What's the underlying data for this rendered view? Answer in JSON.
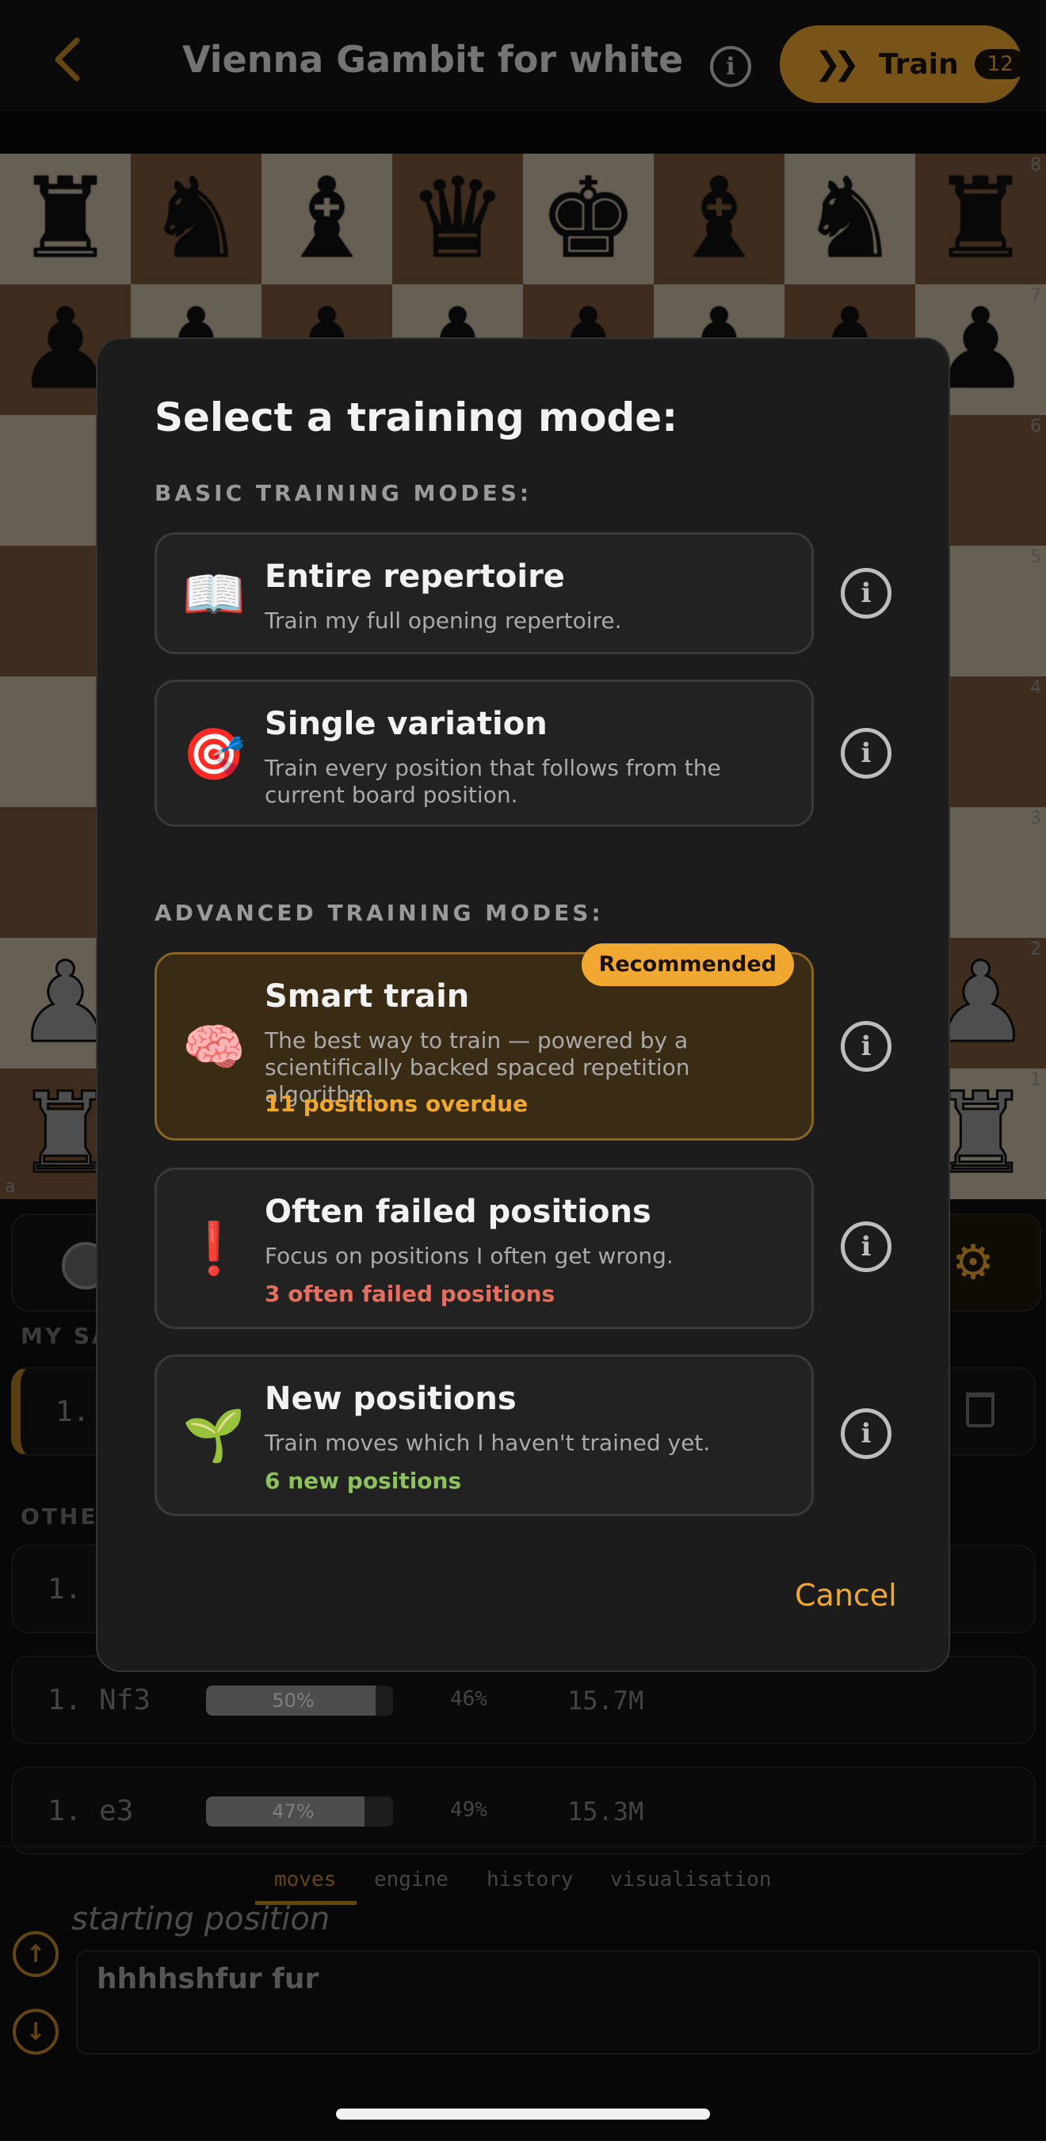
{
  "header": {
    "title": "Vienna Gambit for white",
    "train_label": "Train",
    "train_count": "12"
  },
  "board": {
    "rank_labels": [
      "8",
      "7",
      "6",
      "5",
      "4",
      "3",
      "2",
      "1"
    ],
    "file_label": "a"
  },
  "below_board": {
    "saved_section_label": "MY SA",
    "saved_move": "1.",
    "other_section_label": "OTHE",
    "other_moves": [
      {
        "move": "1.",
        "bar": "",
        "pct": "",
        "games": ""
      },
      {
        "move": "1. Nf3",
        "bar": "50%",
        "pct": "46%",
        "games": "15.7M"
      },
      {
        "move": "1. e3",
        "bar": "47%",
        "pct": "49%",
        "games": "15.3M"
      }
    ],
    "tabs": [
      "moves",
      "engine",
      "history",
      "visualisation"
    ],
    "starting_position": "starting position",
    "comment": "hhhhshfur fur"
  },
  "dialog": {
    "title": "Select a training mode:",
    "basic_label": "BASIC TRAINING MODES:",
    "advanced_label": "ADVANCED TRAINING MODES:",
    "modes": [
      {
        "icon": "📖",
        "title": "Entire repertoire",
        "desc": "Train my full opening repertoire.",
        "status": ""
      },
      {
        "icon": "🎯",
        "title": "Single variation",
        "desc": "Train every position that follows from the current board position.",
        "status": ""
      },
      {
        "icon": "🧠",
        "title": "Smart train",
        "desc": "The best way to train — powered by a scientifically backed spaced repetition algorithm.",
        "status": "11 positions overdue",
        "badge": "Recommended"
      },
      {
        "icon": "❗",
        "title": "Often failed positions",
        "desc": "Focus on positions I often get wrong.",
        "status": "3 often failed positions"
      },
      {
        "icon": "🌱",
        "title": "New positions",
        "desc": "Train moves which I haven't trained yet.",
        "status": "6 new positions"
      }
    ],
    "info_symbol": "i",
    "cancel_label": "Cancel"
  },
  "colors": {
    "accent": "#f0a830",
    "overdue": "#f0a830",
    "failed": "#e07060",
    "new": "#8cc060"
  }
}
